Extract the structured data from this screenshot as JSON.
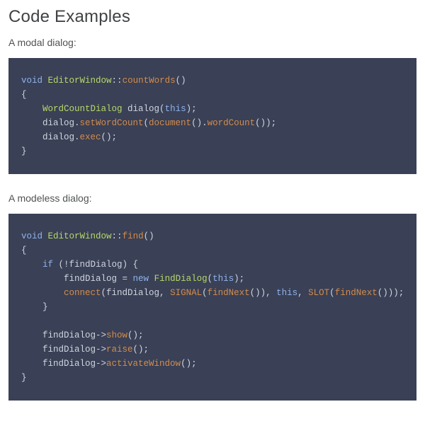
{
  "heading": "Code Examples",
  "block1": {
    "caption": "A modal dialog:",
    "code": {
      "kw_void": "void",
      "type_editor": "EditorWindow",
      "fn_count": "countWords",
      "type_wcd": "WordCountDialog",
      "kw_this": "this",
      "fn_swc": "setWordCount",
      "fn_doc": "document",
      "fn_wc": "wordCount",
      "fn_exec": "exec",
      "t1": "::",
      "t2": "()",
      "t3": "{",
      "t4": "    ",
      "t5": " dialog(",
      "t6": ");",
      "t7": "    dialog.",
      "t8": "(",
      "t9": "().",
      "t10": "());",
      "t11": "();",
      "t12": "}"
    }
  },
  "block2": {
    "caption": "A modeless dialog:",
    "code": {
      "kw_void": "void",
      "type_editor": "EditorWindow",
      "fn_find": "find",
      "kw_if": "if",
      "kw_new": "new",
      "type_fd": "FindDialog",
      "kw_this1": "this",
      "kw_this2": "this",
      "fn_connect": "connect",
      "fn_signal": "SIGNAL",
      "fn_fn": "findNext",
      "fn_slot": "SLOT",
      "fn_fn2": "findNext",
      "fn_show": "show",
      "fn_raise": "raise",
      "fn_aw": "activateWindow",
      "t1": "::",
      "t2": "()",
      "t3": "{",
      "t4": "    ",
      "t5": " (!findDialog) {",
      "t6": "        findDialog = ",
      "t7": " ",
      "t8": "(",
      "t9": ");",
      "t10": "        ",
      "t11": "(findDialog, ",
      "t12": "(",
      "t13": "()), ",
      "t14": ", ",
      "t15": "(",
      "t16": "()));",
      "t17": "    }",
      "t18": "",
      "t19": "    findDialog->",
      "t20": "();",
      "t21": "    findDialog->",
      "t22": "();",
      "t23": "    findDialog->",
      "t24": "();",
      "t25": "}"
    }
  }
}
